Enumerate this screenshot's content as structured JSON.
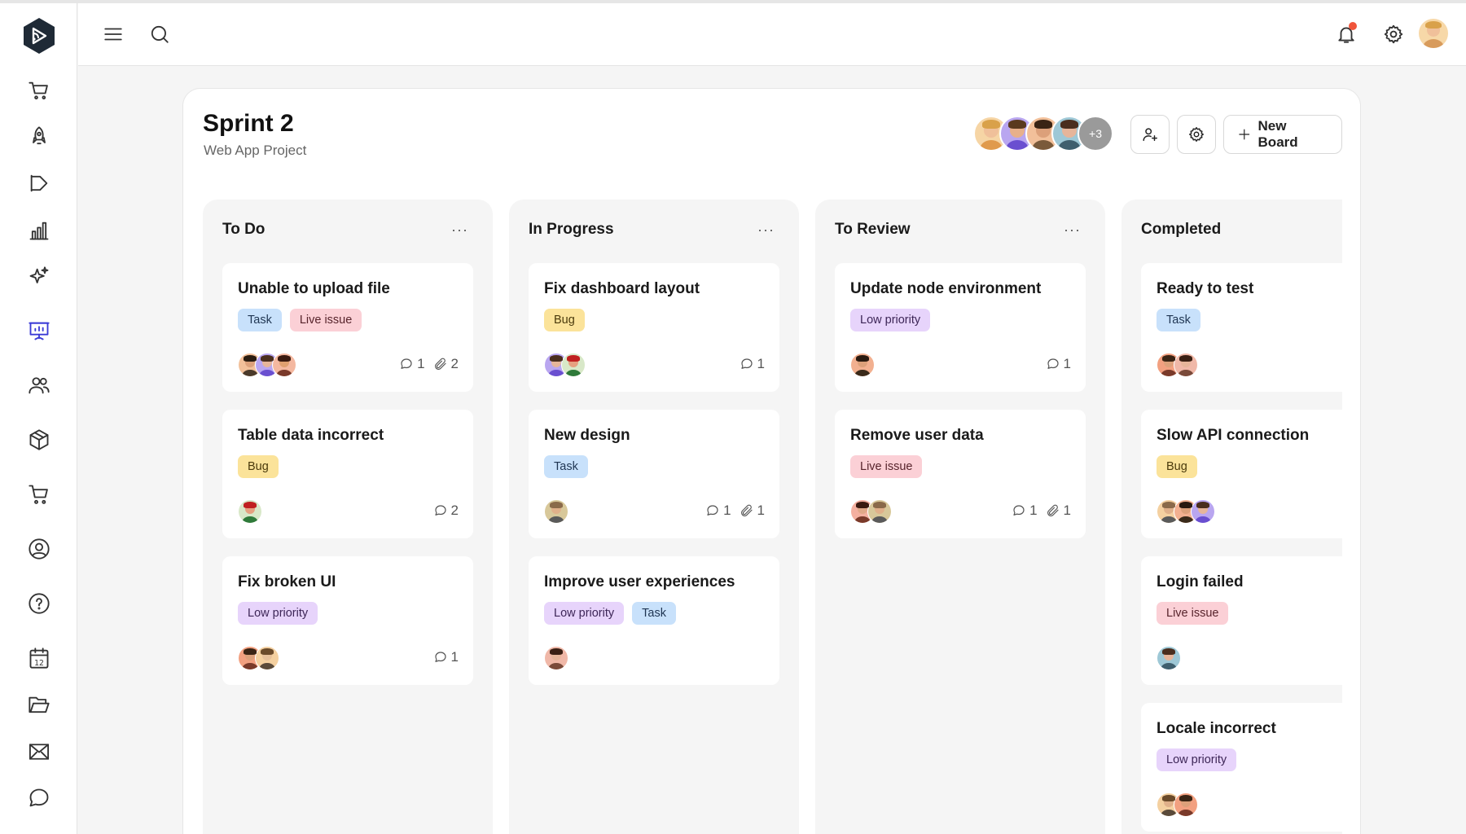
{
  "app": {
    "logo_icon": "app-logo-icon",
    "sidebar_icons": [
      "cart-icon",
      "rocket-icon",
      "megaphone-icon",
      "bar-chart-icon",
      "sparkles-icon",
      "presentation-board-icon",
      "users-icon",
      "package-icon",
      "shopping-cart-icon",
      "user-circle-icon",
      "help-icon",
      "calendar-icon",
      "folder-icon",
      "mail-icon",
      "chat-icon"
    ],
    "sidebar_active": "presentation-board-icon",
    "calendar_day": "12",
    "accent_color": "#3b3bd6",
    "notification_color": "#f0553b"
  },
  "header": {
    "menu_icon": "hamburger-menu-icon",
    "search_icon": "search-icon",
    "notification_icon": "bell-icon",
    "settings_icon": "gear-icon",
    "profile_icon": "user-avatar"
  },
  "board": {
    "title": "Sprint 2",
    "subtitle": "Web App Project",
    "members_extra": "+3",
    "add_member_icon": "add-user-icon",
    "settings_icon": "gear-icon",
    "new_board_label": "New Board"
  },
  "columns": [
    {
      "title": "To Do",
      "menu": "···",
      "cards": [
        {
          "title": "Unable to upload file",
          "tags": [
            "Task",
            "Live issue"
          ],
          "comments": "1",
          "attachments": "2"
        },
        {
          "title": "Table data incorrect",
          "tags": [
            "Bug"
          ],
          "comments": "2",
          "attachments": ""
        },
        {
          "title": "Fix broken UI",
          "tags": [
            "Low priority"
          ],
          "comments": "1",
          "attachments": ""
        }
      ]
    },
    {
      "title": "In Progress",
      "menu": "···",
      "cards": [
        {
          "title": "Fix dashboard layout",
          "tags": [
            "Bug"
          ],
          "comments": "1",
          "attachments": ""
        },
        {
          "title": "New design",
          "tags": [
            "Task"
          ],
          "comments": "1",
          "attachments": "1"
        },
        {
          "title": "Improve user experiences",
          "tags": [
            "Low priority",
            "Task"
          ],
          "comments": "",
          "attachments": ""
        }
      ]
    },
    {
      "title": "To Review",
      "menu": "···",
      "cards": [
        {
          "title": "Update node environment",
          "tags": [
            "Low priority"
          ],
          "comments": "1",
          "attachments": ""
        },
        {
          "title": "Remove user data",
          "tags": [
            "Live issue"
          ],
          "comments": "1",
          "attachments": "1"
        }
      ]
    },
    {
      "title": "Completed",
      "menu": "",
      "cards": [
        {
          "title": "Ready to test",
          "tags": [
            "Task"
          ],
          "comments": "",
          "attachments": ""
        },
        {
          "title": "Slow API connection",
          "tags": [
            "Bug"
          ],
          "comments": "",
          "attachments": ""
        },
        {
          "title": "Login failed",
          "tags": [
            "Live issue"
          ],
          "comments": "",
          "attachments": ""
        },
        {
          "title": "Locale incorrect",
          "tags": [
            "Low priority"
          ],
          "comments": "",
          "attachments": ""
        }
      ]
    }
  ]
}
